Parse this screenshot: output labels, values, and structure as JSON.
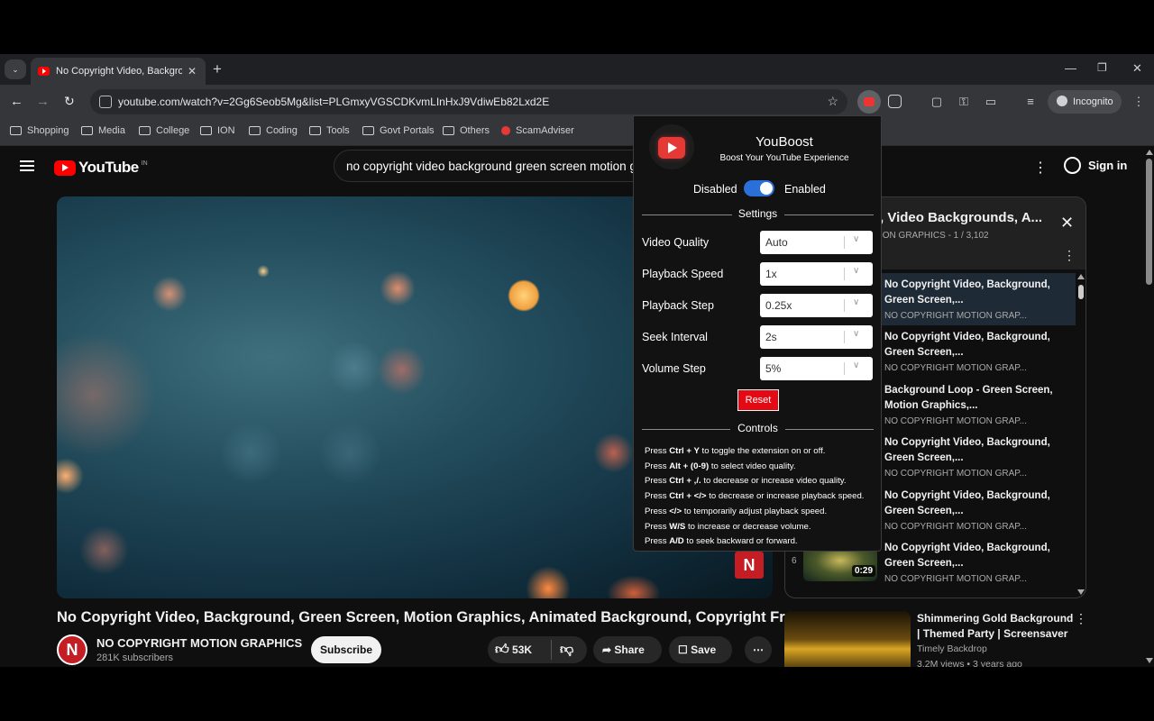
{
  "browser": {
    "tab_title": "No Copyright Video, Background, Green Screen, Motion Graphics",
    "url": "youtube.com/watch?v=2Gg6Seob5Mg&list=PLGmxyVGSCDKvmLInHxJ9VdiwEb82Lxd2E",
    "incognito_label": "Incognito",
    "bookmarks": [
      "Shopping",
      "Media",
      "College",
      "ION",
      "Coding",
      "Tools",
      "Govt Portals",
      "Others",
      "ScamAdviser"
    ]
  },
  "youtube": {
    "logo_text": "YouTube",
    "country_code": "IN",
    "search_query": "no copyright video background green screen motion g",
    "signin_label": "Sign in",
    "video": {
      "title": "No Copyright Video, Background, Green Screen, Motion Graphics, Animated Background, Copyright Free",
      "channel": "NO COPYRIGHT MOTION GRAPHICS",
      "subscribers": "281K subscribers",
      "subscribe_label": "Subscribe",
      "likes": "53K",
      "share_label": "Share",
      "save_label": "Save",
      "watermark": "N",
      "channel_avatar_letter": "N"
    },
    "playlist": {
      "title": ", Video Backgrounds, A...",
      "subtitle": "ION GRAPHICS - 1 / 3,102",
      "items": [
        {
          "title": "No Copyright Video, Background, Green Screen,...",
          "channel": "NO COPYRIGHT MOTION GRAP..."
        },
        {
          "title": "No Copyright Video, Background, Green Screen,...",
          "channel": "NO COPYRIGHT MOTION GRAP..."
        },
        {
          "title": "Background Loop - Green Screen, Motion Graphics,...",
          "channel": "NO COPYRIGHT MOTION GRAP..."
        },
        {
          "title": "No Copyright Video, Background, Green Screen,...",
          "channel": "NO COPYRIGHT MOTION GRAP..."
        },
        {
          "title": "No Copyright Video, Background, Green Screen,...",
          "channel": "NO COPYRIGHT MOTION GRAP..."
        },
        {
          "title": "No Copyright Video, Background, Green Screen,...",
          "channel": "NO COPYRIGHT MOTION GRAP...",
          "index": "6",
          "duration": "0:29"
        }
      ]
    },
    "recommendation": {
      "title": "Shimmering Gold Background | Themed Party | Screensaver",
      "channel": "Timely Backdrop",
      "meta": "3.2M views • 3 years ago"
    }
  },
  "popup": {
    "name": "YouBoost",
    "tagline": "Boost Your YouTube Experience",
    "disabled_label": "Disabled",
    "enabled_label": "Enabled",
    "enabled": true,
    "settings_heading": "Settings",
    "settings": [
      {
        "label": "Video Quality",
        "value": "Auto"
      },
      {
        "label": "Playback Speed",
        "value": "1x"
      },
      {
        "label": "Playback Step",
        "value": "0.25x"
      },
      {
        "label": "Seek Interval",
        "value": "2s"
      },
      {
        "label": "Volume Step",
        "value": "5%"
      }
    ],
    "reset_label": "Reset",
    "controls_heading": "Controls",
    "controls": [
      {
        "pre": "Press ",
        "key": "Ctrl + Y",
        "post": " to toggle the extension on or off."
      },
      {
        "pre": "Press ",
        "key": "Alt + (0-9)",
        "post": " to select video quality."
      },
      {
        "pre": "Press ",
        "key": "Ctrl + ,/.",
        "post": " to decrease or increase video quality."
      },
      {
        "pre": "Press ",
        "key": "Ctrl + </>",
        "post": " to decrease or increase playback speed."
      },
      {
        "pre": "Press ",
        "key": "</>",
        "post": " to temporarily adjust playback speed."
      },
      {
        "pre": "Press ",
        "key": "W/S",
        "post": " to increase or decrease volume."
      },
      {
        "pre": "Press ",
        "key": "A/D",
        "post": " to seek backward or forward."
      }
    ]
  },
  "colors": {
    "accent": "#ff0000",
    "toggle": "#2b6fd8",
    "reset": "#e50914"
  }
}
